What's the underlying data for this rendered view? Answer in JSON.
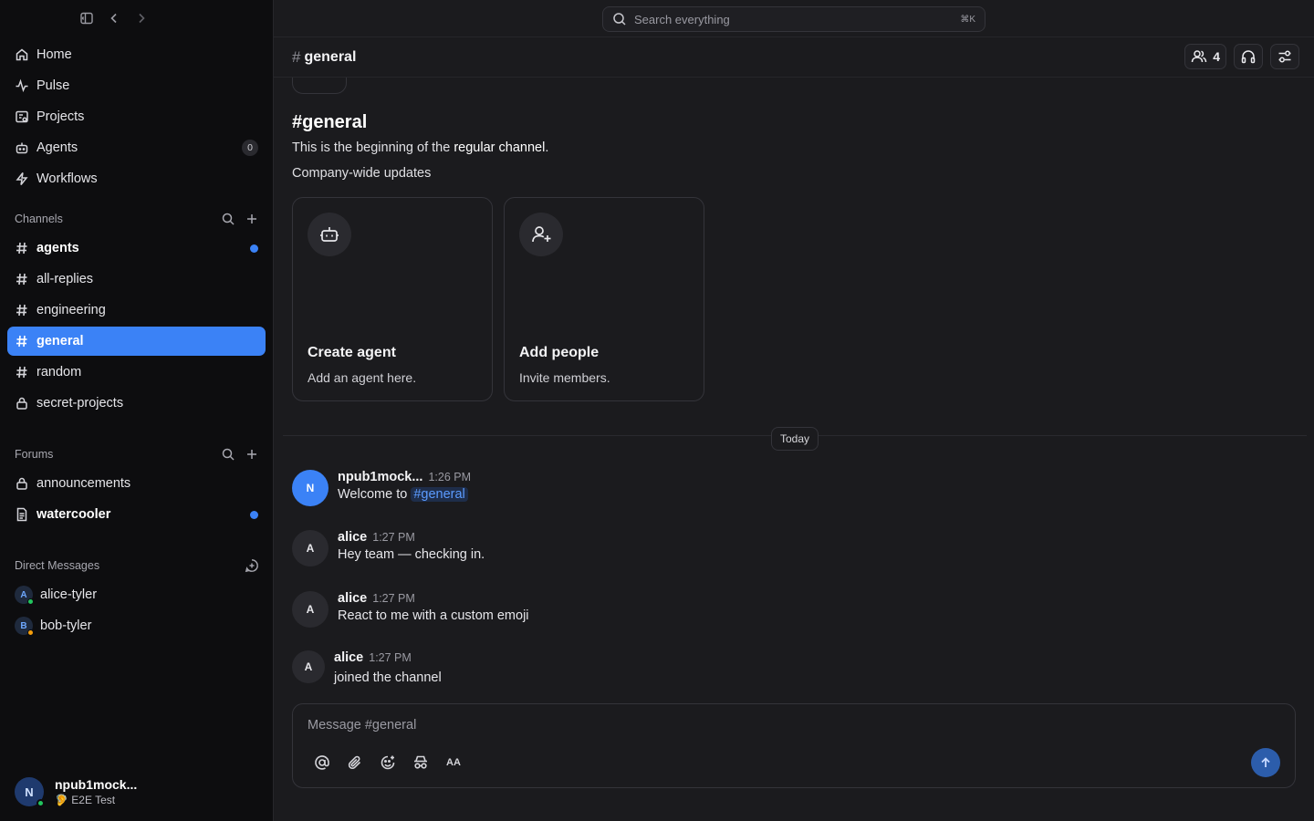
{
  "sidebar": {
    "nav": [
      {
        "label": "Home",
        "icon": "home-icon"
      },
      {
        "label": "Pulse",
        "icon": "activity-icon"
      },
      {
        "label": "Projects",
        "icon": "projects-icon"
      },
      {
        "label": "Agents",
        "icon": "bot-icon",
        "badge": "0"
      },
      {
        "label": "Workflows",
        "icon": "bolt-icon"
      }
    ],
    "channels_title": "Channels",
    "channels": [
      {
        "label": "agents",
        "unread": true
      },
      {
        "label": "all-replies"
      },
      {
        "label": "engineering"
      },
      {
        "label": "general",
        "active": true
      },
      {
        "label": "random"
      },
      {
        "label": "secret-projects",
        "private": true
      }
    ],
    "forums_title": "Forums",
    "forums": [
      {
        "label": "announcements"
      },
      {
        "label": "watercooler",
        "unread": true
      }
    ],
    "dms_title": "Direct Messages",
    "dms": [
      {
        "label": "alice-tyler",
        "initial": "A",
        "presence_color": "#22c55e"
      },
      {
        "label": "bob-tyler",
        "initial": "B",
        "presence_color": "#f59e0b"
      }
    ],
    "user": {
      "initial": "N",
      "name": "npub1mock...",
      "status": "E2E Test"
    }
  },
  "topbar": {
    "search_placeholder": "Search everything",
    "shortcut": "⌘K"
  },
  "channel_header": {
    "hash": "#",
    "name": "general",
    "member_count": "4"
  },
  "intro": {
    "title": "#general",
    "line_prefix": "This is the beginning of the ",
    "line_bold": "regular channel",
    "line_suffix": ".",
    "description": "Company-wide updates"
  },
  "cards": [
    {
      "title": "Create agent",
      "subtitle": "Add an agent here.",
      "icon": "bot-icon"
    },
    {
      "title": "Add people",
      "subtitle": "Invite members.",
      "icon": "user-plus-icon"
    }
  ],
  "day_divider": "Today",
  "messages": [
    {
      "initial": "N",
      "author": "npub1mock...",
      "time": "1:26 PM",
      "text": "Welcome to ",
      "mention": "#general"
    },
    {
      "initial": "A",
      "author": "alice",
      "time": "1:27 PM",
      "text": "Hey team — checking in."
    },
    {
      "initial": "A",
      "author": "alice",
      "time": "1:27 PM",
      "text": "React to me with a custom emoji"
    },
    {
      "initial": "A",
      "author": "alice",
      "time": "1:27 PM",
      "text": "joined the channel"
    }
  ],
  "composer": {
    "placeholder": "Message #general",
    "format_label": "AA"
  },
  "colors": {
    "accent": "#3b82f6",
    "background": "#1b1b1e",
    "sidebar": "#0d0d0f"
  }
}
